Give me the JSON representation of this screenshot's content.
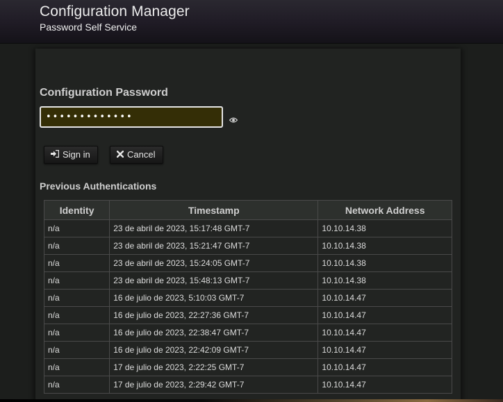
{
  "header": {
    "title": "Configuration Manager",
    "subtitle": "Password Self Service"
  },
  "login": {
    "section_title": "Configuration Password",
    "password_value": "•••••••••••••",
    "show_password_icon": "eye-icon",
    "signin_label": "Sign in",
    "signin_icon": "sign-in-icon",
    "cancel_label": "Cancel",
    "cancel_icon": "close-icon",
    "input_bg_color": "#342e06"
  },
  "history": {
    "title": "Previous Authentications",
    "columns": [
      "Identity",
      "Timestamp",
      "Network Address"
    ],
    "rows": [
      {
        "identity": "n/a",
        "timestamp": "23 de abril de 2023, 15:17:48 GMT-7",
        "address": "10.10.14.38"
      },
      {
        "identity": "n/a",
        "timestamp": "23 de abril de 2023, 15:21:47 GMT-7",
        "address": "10.10.14.38"
      },
      {
        "identity": "n/a",
        "timestamp": "23 de abril de 2023, 15:24:05 GMT-7",
        "address": "10.10.14.38"
      },
      {
        "identity": "n/a",
        "timestamp": "23 de abril de 2023, 15:48:13 GMT-7",
        "address": "10.10.14.38"
      },
      {
        "identity": "n/a",
        "timestamp": "16 de julio de 2023, 5:10:03 GMT-7",
        "address": "10.10.14.47"
      },
      {
        "identity": "n/a",
        "timestamp": "16 de julio de 2023, 22:27:36 GMT-7",
        "address": "10.10.14.47"
      },
      {
        "identity": "n/a",
        "timestamp": "16 de julio de 2023, 22:38:47 GMT-7",
        "address": "10.10.14.47"
      },
      {
        "identity": "n/a",
        "timestamp": "16 de julio de 2023, 22:42:09 GMT-7",
        "address": "10.10.14.47"
      },
      {
        "identity": "n/a",
        "timestamp": "17 de julio de 2023, 2:22:25 GMT-7",
        "address": "10.10.14.47"
      },
      {
        "identity": "n/a",
        "timestamp": "17 de julio de 2023, 2:29:42 GMT-7",
        "address": "10.10.14.47"
      }
    ]
  }
}
